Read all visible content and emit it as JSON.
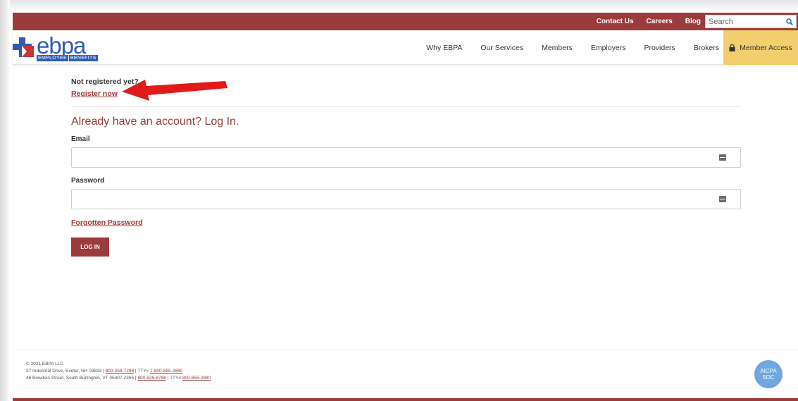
{
  "topbar": {
    "links": [
      "Contact Us",
      "Careers",
      "Blog"
    ],
    "search_placeholder": "Search"
  },
  "brand": {
    "name": "ebpa",
    "tag_left": "EMPLOYEE",
    "tag_right": "BENEFITS"
  },
  "nav": {
    "items": [
      "Why EBPA",
      "Our Services",
      "Members",
      "Employers",
      "Providers",
      "Brokers"
    ],
    "member_access": "Member Access"
  },
  "login": {
    "not_registered": "Not registered yet?",
    "register_link": "Register now",
    "heading": "Already have an account? Log In.",
    "email_label": "Email",
    "password_label": "Password",
    "forgot_link": "Forgotten Password",
    "submit": "LOG IN"
  },
  "footer": {
    "copyright": "© 2021 EBPA LLC",
    "addr1": "37 Industrial Drive, Exeter, NH 03833 | ",
    "phone1": "800-258-7298",
    "tty1_label": " | TTY# ",
    "tty1": "1-800-855-2880",
    "addr2": "46 Bowdoin Street, South Burlington, VT 05407-2365 | ",
    "phone2": "800-525-8788",
    "tty2_label": " | TTY# ",
    "tty2": "800-855-2880",
    "badge_line1": "AICPA",
    "badge_line2": "SOC"
  },
  "colors": {
    "brand_red": "#9b3b3b",
    "brand_blue": "#2f5bb7",
    "member_yellow": "#f2cf6c",
    "annotation_red": "#e11a1a"
  }
}
